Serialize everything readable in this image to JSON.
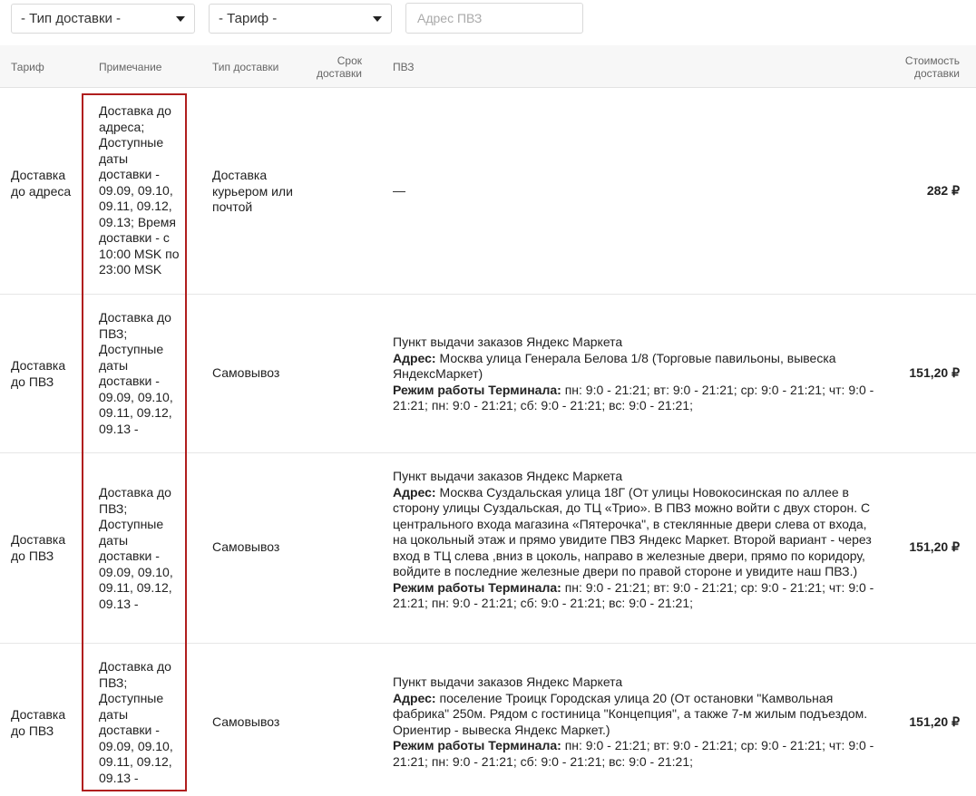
{
  "filters": {
    "delivery_type": "- Тип доставки -",
    "tariff": "- Тариф -",
    "pvz_placeholder": "Адрес ПВЗ"
  },
  "table": {
    "headers": {
      "tariff": "Тариф",
      "note": "Примечание",
      "type": "Тип доставки",
      "term_line1": "Срок",
      "term_line2": "доставки",
      "pvz": "ПВЗ",
      "cost_line1": "Стоимость",
      "cost_line2": "доставки"
    },
    "rows": [
      {
        "tariff": "Доставка до адреса",
        "note": "Доставка до адреса; Доступные даты доставки - 09.09, 09.10, 09.11, 09.12, 09.13; Время доставки - с 10:00 MSK по 23:00 MSK",
        "type": "Доставка курьером или почтой",
        "pvz_dash": "—",
        "cost": "282 ₽"
      },
      {
        "tariff": "Доставка до ПВЗ",
        "note": "Доставка до ПВЗ; Доступные даты доставки - 09.09, 09.10, 09.11, 09.12, 09.13 -",
        "type": "Самовывоз",
        "pvz_title": "Пункт выдачи заказов Яндекс Маркета",
        "address_label": "Адрес:",
        "address": "Москва улица Генерала Белова 1/8 (Торговые павильоны, вывеска ЯндексМаркет)",
        "hours_label": "Режим работы Терминала:",
        "hours": "пн: 9:0 - 21:21; вт: 9:0 - 21:21; ср: 9:0 - 21:21; чт: 9:0 - 21:21; пн: 9:0 - 21:21; сб: 9:0 - 21:21; вс: 9:0 - 21:21;",
        "cost": "151,20 ₽"
      },
      {
        "tariff": "Доставка до ПВЗ",
        "note": "Доставка до ПВЗ; Доступные даты доставки - 09.09, 09.10, 09.11, 09.12, 09.13 -",
        "type": "Самовывоз",
        "pvz_title": "Пункт выдачи заказов Яндекс Маркета",
        "address_label": "Адрес:",
        "address": "Москва Суздальская улица 18Г (От улицы Новокосинская по аллее в сторону улицы Суздальская, до ТЦ «Трио». В ПВЗ можно войти с двух сторон. С центрального входа магазина «Пятерочка\", в стеклянные двери слева от входа, на цокольный этаж и прямо увидите ПВЗ Яндекс Маркет. Второй вариант - через вход в ТЦ слева ,вниз в цоколь, направо в железные двери, прямо по коридору, войдите в последние железные двери по правой стороне и увидите наш ПВЗ.)",
        "hours_label": "Режим работы Терминала:",
        "hours": "пн: 9:0 - 21:21; вт: 9:0 - 21:21; ср: 9:0 - 21:21; чт: 9:0 - 21:21; пн: 9:0 - 21:21; сб: 9:0 - 21:21; вс: 9:0 - 21:21;",
        "cost": "151,20 ₽"
      },
      {
        "tariff": "Доставка до ПВЗ",
        "note": "Доставка до ПВЗ; Доступные даты доставки - 09.09, 09.10, 09.11, 09.12, 09.13 -",
        "type": "Самовывоз",
        "pvz_title": "Пункт выдачи заказов Яндекс Маркета",
        "address_label": "Адрес:",
        "address": "поселение Троицк Городская улица 20 (От остановки \"Камвольная фабрика\" 250м. Рядом с гостиница \"Концепция\", а также 7-м жилым подъездом. Ориентир - вывеска Яндекс Маркет.)",
        "hours_label": "Режим работы Терминала:",
        "hours": "пн: 9:0 - 21:21; вт: 9:0 - 21:21; ср: 9:0 - 21:21; чт: 9:0 - 21:21; пн: 9:0 - 21:21; сб: 9:0 - 21:21; вс: 9:0 - 21:21;",
        "cost": "151,20 ₽"
      }
    ]
  }
}
